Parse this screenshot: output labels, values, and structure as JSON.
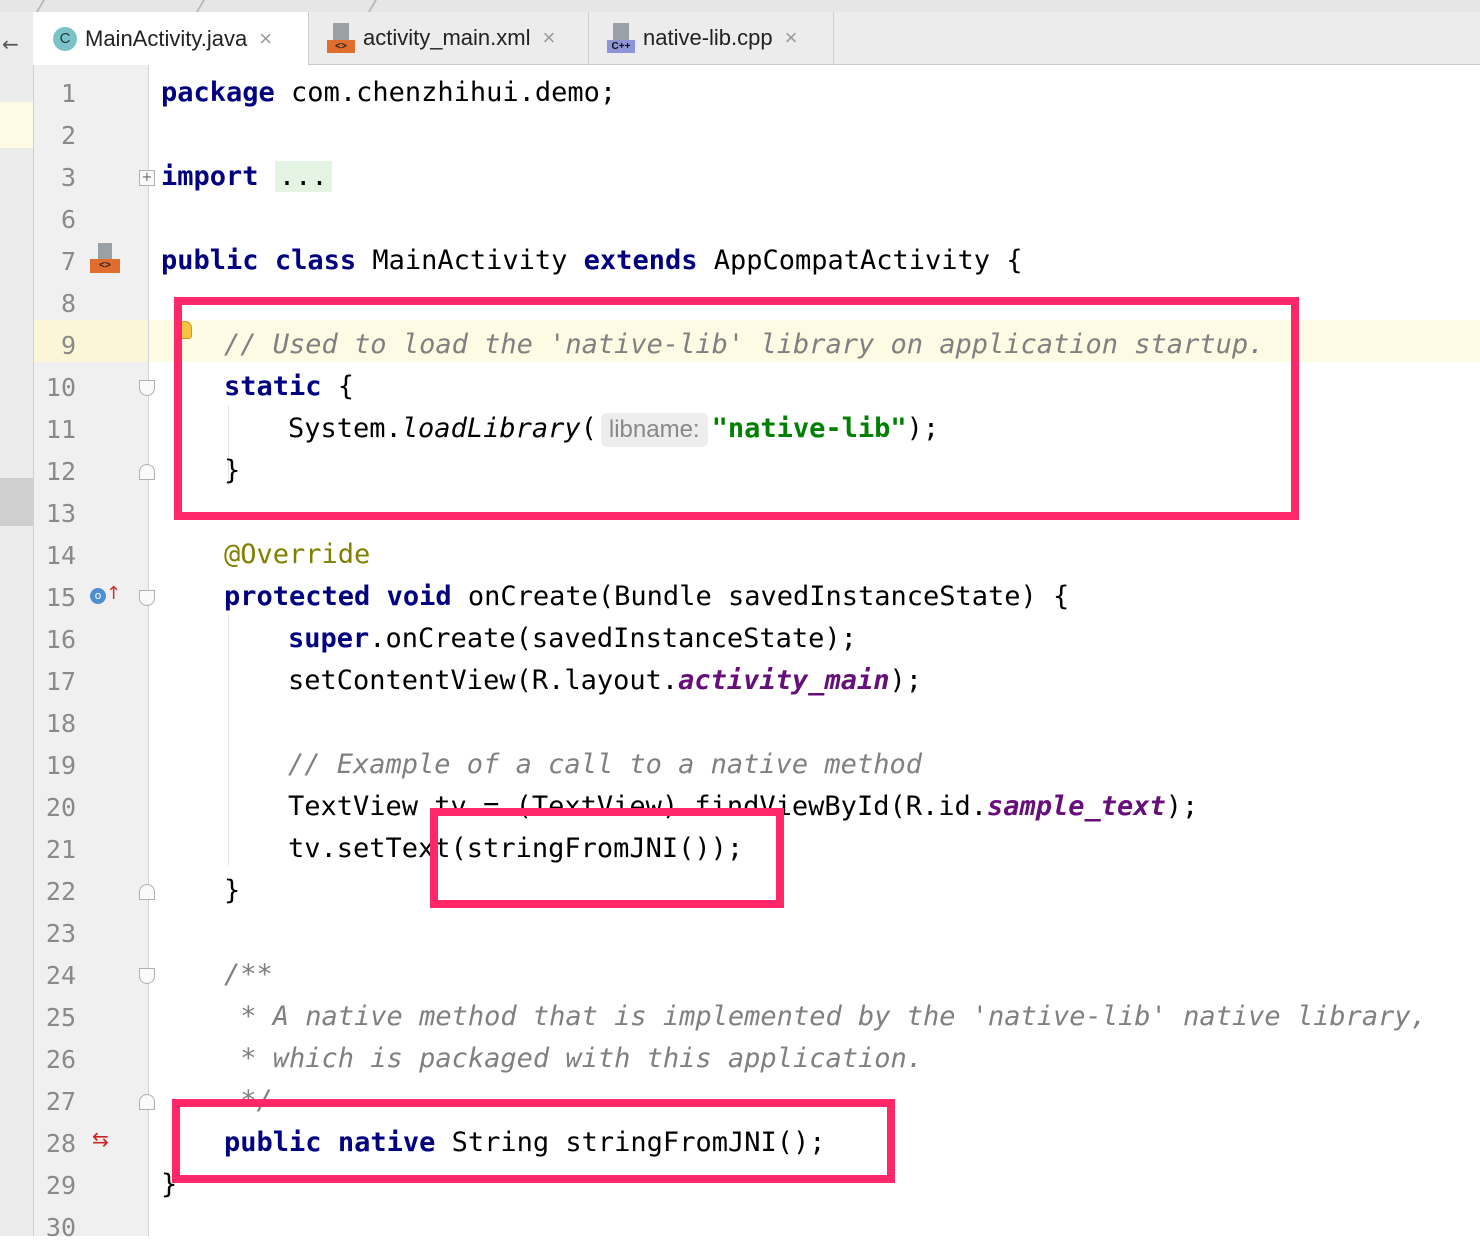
{
  "tabs": [
    {
      "label": "MainActivity.java",
      "icon": "java-class-icon",
      "active": true
    },
    {
      "label": "activity_main.xml",
      "icon": "xml-file-icon",
      "active": false
    },
    {
      "label": "native-lib.cpp",
      "icon": "cpp-file-icon",
      "active": false
    }
  ],
  "icons": {
    "class_letter": "C",
    "xml_badge": "<>",
    "cpp_badge": "C++",
    "close": "×",
    "back": "←"
  },
  "lines": {
    "l1": "1",
    "l2": "2",
    "l3": "3",
    "l6": "6",
    "l7": "7",
    "l8": "8",
    "l9": "9",
    "l10": "10",
    "l11": "11",
    "l12": "12",
    "l13": "13",
    "l14": "14",
    "l15": "15",
    "l16": "16",
    "l17": "17",
    "l18": "18",
    "l19": "19",
    "l20": "20",
    "l21": "21",
    "l22": "22",
    "l23": "23",
    "l24": "24",
    "l25": "25",
    "l26": "26",
    "l27": "27",
    "l28": "28",
    "l29": "29",
    "l30": "30"
  },
  "code": {
    "l1_kw": "package",
    "l1_rest": " com.chenzhihui.demo;",
    "l3_kw": "import",
    "l3_fold": "...",
    "l7_kw1": "public",
    "l7_kw2": "class",
    "l7_name": " MainActivity ",
    "l7_kw3": "extends",
    "l7_rest": " AppCompatActivity {",
    "l9_comment": "// Used to load the 'native-lib' library on application startup.",
    "l10_kw": "static",
    "l10_rest": " {",
    "l11_pre": "System.",
    "l11_method": "loadLibrary",
    "l11_paren": "(",
    "l11_hint": "libname:",
    "l11_str": "\"native-lib\"",
    "l11_end": ");",
    "l12": "}",
    "l14_ann": "@Override",
    "l15_kw1": "protected",
    "l15_kw2": "void",
    "l15_rest": " onCreate(Bundle savedInstanceState) {",
    "l16_kw": "super",
    "l16_rest": ".onCreate(savedInstanceState);",
    "l17_pre": "setContentView(R.layout.",
    "l17_field": "activity_main",
    "l17_end": ");",
    "l19_comment": "// Example of a call to a native method",
    "l20_pre": "TextView tv = (TextView) findViewById(R.id.",
    "l20_field": "sample_text",
    "l20_end": ");",
    "l21": "tv.setText(stringFromJNI());",
    "l22": "}",
    "l24": "/**",
    "l25": " * A native method that is implemented by the 'native-lib' native library,",
    "l26": " * which is packaged with this application.",
    "l27": " */",
    "l28_kw1": "public",
    "l28_kw2": "native",
    "l28_rest": " String stringFromJNI();",
    "l29": "}"
  },
  "colors": {
    "keyword": "#000080",
    "comment": "#808080",
    "string": "#008000",
    "annotation": "#808000",
    "field": "#660e7a",
    "highlight": "#ff2768"
  }
}
